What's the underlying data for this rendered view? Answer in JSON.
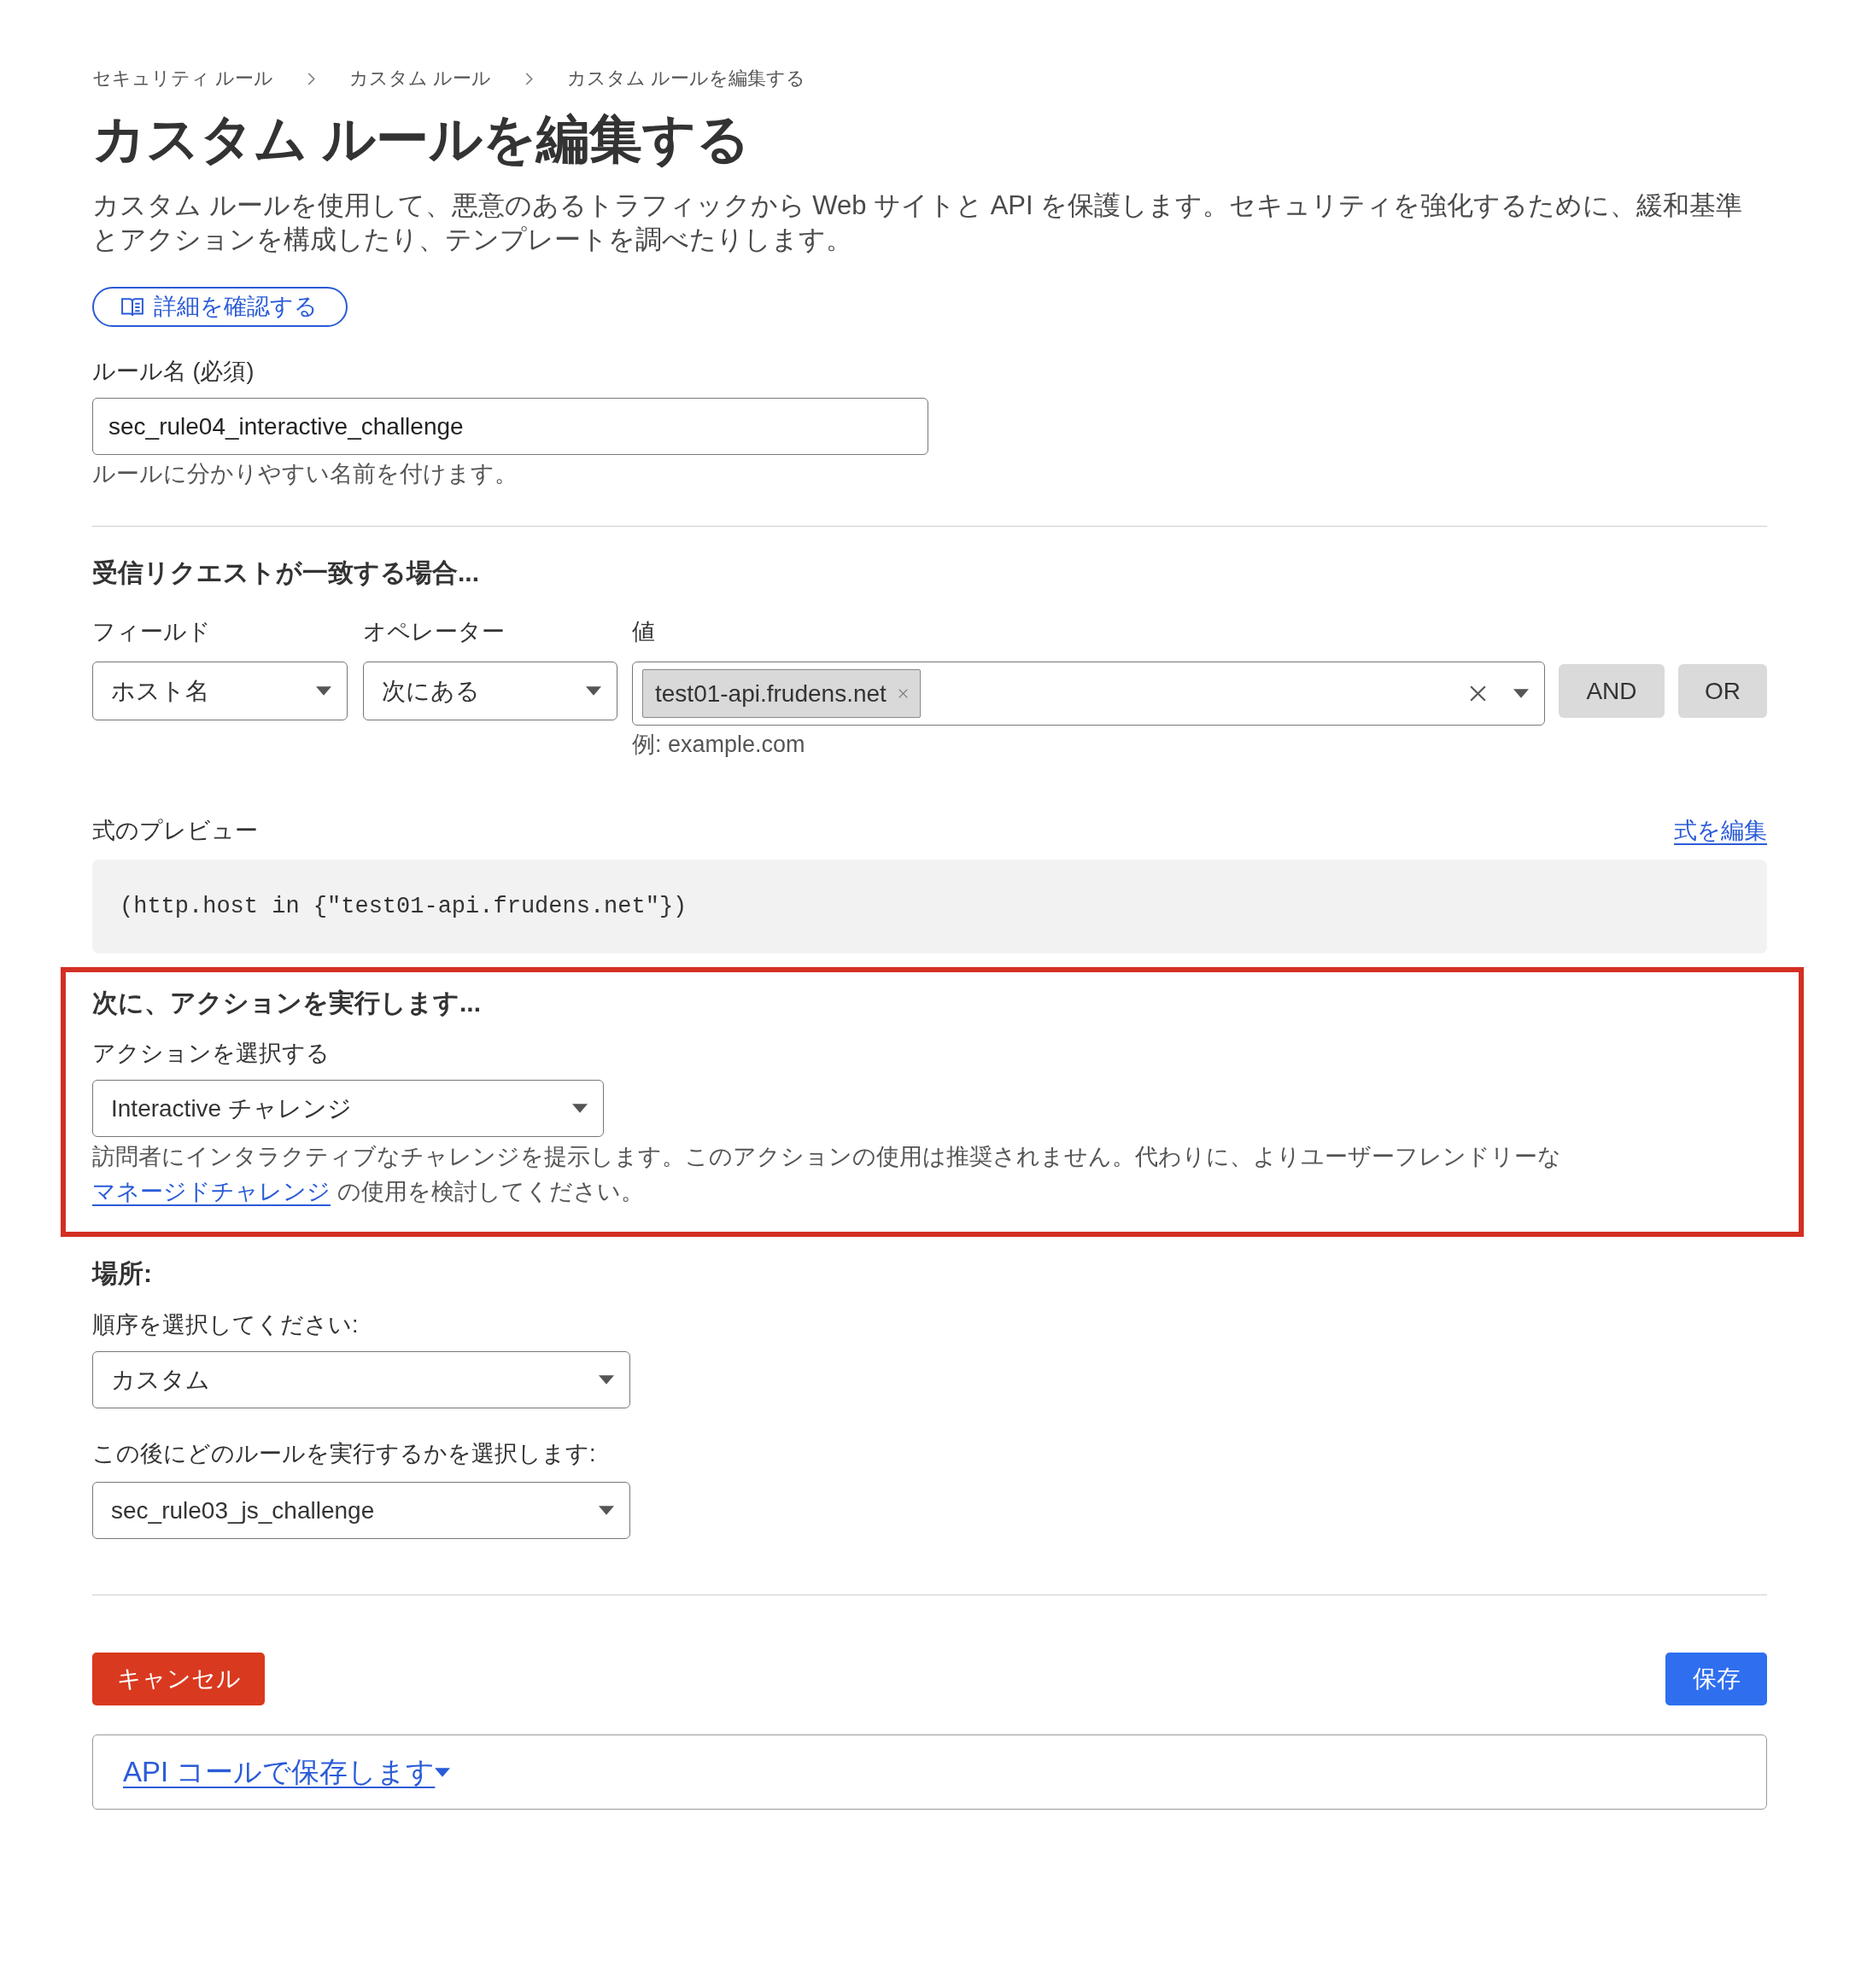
{
  "breadcrumb": [
    "セキュリティ ルール",
    "カスタム ルール",
    "カスタム ルールを編集する"
  ],
  "page_title": "カスタム ルールを編集する",
  "description": "カスタム ルールを使用して、悪意のあるトラフィックから Web サイトと API を保護します。セキュリティを強化するために、緩和基準とアクションを構成したり、テンプレートを調べたりします。",
  "learn_more_button": "詳細を確認する",
  "rule_name": {
    "label": "ルール名 (必須)",
    "value": "sec_rule04_interactive_challenge",
    "help": "ルールに分かりやすい名前を付けます。"
  },
  "match_section": {
    "heading": "受信リクエストが一致する場合...",
    "field": {
      "label": "フィールド",
      "value": "ホスト名"
    },
    "operator": {
      "label": "オペレーター",
      "value": "次にある"
    },
    "value": {
      "label": "値",
      "tags": [
        "test01-api.frudens.net"
      ],
      "hint": "例: example.com"
    },
    "buttons": [
      "AND",
      "OR"
    ]
  },
  "expression_preview": {
    "label": "式のプレビュー",
    "edit_link": "式を編集",
    "code": "(http.host in {\"test01-api.frudens.net\"})"
  },
  "action_section": {
    "highlighted": true,
    "heading": "次に、アクションを実行します...",
    "select_label": "アクションを選択する",
    "value": "Interactive チャレンジ",
    "note": "訪問者にインタラクティブなチャレンジを提示します。このアクションの使用は推奨されません。代わりに、よりユーザーフレンドリーな",
    "note_link": "マネージドチャレンジ",
    "note_tail": "の使用を検討してください。"
  },
  "placement": {
    "heading": "場所:",
    "order": {
      "label": "順序を選択してください:",
      "value": "カスタム"
    },
    "after_rule": {
      "label": "この後にどのルールを実行するかを選択します:",
      "value": "sec_rule03_js_challenge"
    }
  },
  "footer": {
    "cancel": "キャンセル",
    "save": "保存",
    "api_link": "API コールで保存します"
  }
}
